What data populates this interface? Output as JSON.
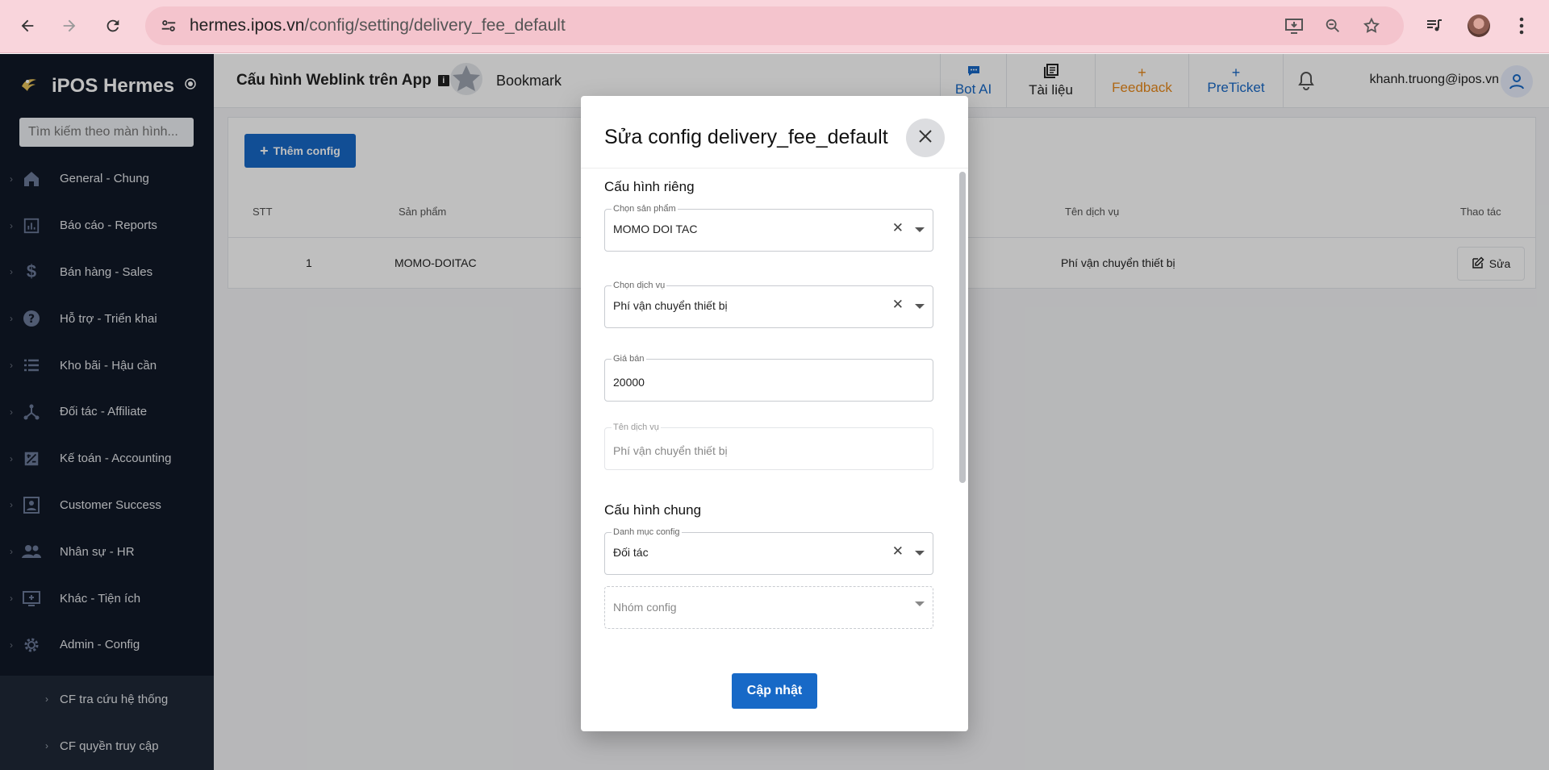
{
  "browser": {
    "url_host": "hermes.ipos.vn",
    "url_path": "/config/setting/delivery_fee_default"
  },
  "sidebar": {
    "brand": "iPOS Hermes",
    "search_placeholder": "Tìm kiếm theo màn hình...",
    "items": [
      {
        "label": "General - Chung",
        "icon": "home-icon"
      },
      {
        "label": "Báo cáo - Reports",
        "icon": "report-icon"
      },
      {
        "label": "Bán hàng - Sales",
        "icon": "dollar-icon"
      },
      {
        "label": "Hỗ trợ - Triển khai",
        "icon": "help-icon"
      },
      {
        "label": "Kho bãi - Hậu cần",
        "icon": "list-icon"
      },
      {
        "label": "Đối tác - Affiliate",
        "icon": "network-icon"
      },
      {
        "label": "Kế toán - Accounting",
        "icon": "accounting-icon"
      },
      {
        "label": "Customer Success",
        "icon": "customer-icon"
      },
      {
        "label": "Nhân sự - HR",
        "icon": "people-icon"
      },
      {
        "label": "Khác - Tiện ích",
        "icon": "monitor-icon"
      },
      {
        "label": "Admin - Config",
        "icon": "gear-icon"
      }
    ],
    "sub_items": [
      {
        "label": "CF tra cứu hệ thống"
      },
      {
        "label": "CF quyền truy cập"
      }
    ]
  },
  "header": {
    "title": "Cấu hình Weblink trên App",
    "bookmark_label": "Bookmark",
    "bot_ai": "Bot AI",
    "docs": "Tài liệu",
    "feedback": "Feedback",
    "preticket": "PreTicket",
    "user_email": "khanh.truong@ipos.vn"
  },
  "content": {
    "add_button": "Thêm config",
    "columns": {
      "stt": "STT",
      "product": "Sản phẩm",
      "service_name": "Tên dịch vụ",
      "actions": "Thao tác"
    },
    "rows": [
      {
        "stt": "1",
        "product": "MOMO-DOITAC",
        "service_name": "Phí vận chuyển thiết bị",
        "edit": "Sửa"
      }
    ]
  },
  "modal": {
    "title": "Sửa config delivery_fee_default",
    "section_private": "Cấu hình riêng",
    "section_general": "Cấu hình chung",
    "fields": {
      "product": {
        "label": "Chọn sản phẩm",
        "value": "MOMO DOI TAC"
      },
      "service": {
        "label": "Chọn dịch vụ",
        "value": "Phí vận chuyển thiết bị"
      },
      "price": {
        "label": "Giá bán",
        "value": "20000"
      },
      "service_name": {
        "label": "Tên dịch vụ",
        "value": "Phí vận chuyển thiết bị"
      },
      "category": {
        "label": "Danh mục config",
        "value": "Đối tác"
      },
      "group": {
        "placeholder": "Nhóm config"
      }
    },
    "submit": "Cập nhật"
  },
  "colors": {
    "chrome_bg": "#f9d5dc",
    "sidebar_bg": "#111827",
    "primary": "#1769c7",
    "feedback": "#e8891a",
    "preticket": "#1769c7"
  }
}
